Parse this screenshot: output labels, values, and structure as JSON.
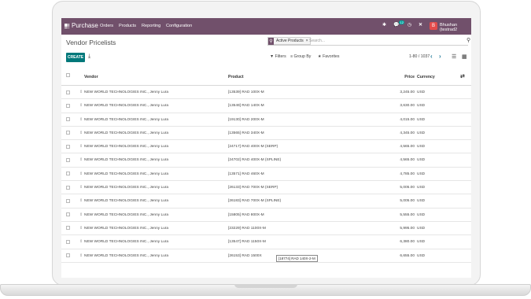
{
  "navbar": {
    "brand": "Purchase",
    "menu": [
      "Orders",
      "Products",
      "Reporting",
      "Configuration"
    ],
    "message_count": "12",
    "user_initial": "B",
    "user_name": "Bhushan (testrad2",
    "bar_color": "#71506b"
  },
  "page": {
    "title": "Vendor Pricelists",
    "create_label": "CREATE"
  },
  "search": {
    "facet_label": "Active Products",
    "facet_close": "×",
    "placeholder": "Search..."
  },
  "controls": {
    "filters": "Filters",
    "group_by": "Group By",
    "favorites": "Favorites",
    "pager": "1-80 / 1037"
  },
  "table": {
    "headers": {
      "vendor": "Vendor",
      "product": "Product",
      "price": "Price",
      "currency": "Currency"
    },
    "rows": [
      {
        "vendor": "NEW WORLD TECHNOLOGIES INC., Jenny Lura",
        "product": "[13539] RAD 100X-M",
        "price": "3,245.00",
        "currency": "USD"
      },
      {
        "vendor": "NEW WORLD TECHNOLOGIES INC., Jenny Lura",
        "product": "[13549] RAD 140X-M",
        "price": "3,630.00",
        "currency": "USD"
      },
      {
        "vendor": "NEW WORLD TECHNOLOGIES INC., Jenny Lura",
        "product": "[19130] RAD 200X-M",
        "price": "4,015.00",
        "currency": "USD"
      },
      {
        "vendor": "NEW WORLD TECHNOLOGIES INC., Jenny Lura",
        "product": "[13565] RAD 340X-M",
        "price": "4,345.00",
        "currency": "USD"
      },
      {
        "vendor": "NEW WORLD TECHNOLOGIES INC., Jenny Lura",
        "product": "[24717] RAD 400X-M (SERP)",
        "price": "4,565.00",
        "currency": "USD"
      },
      {
        "vendor": "NEW WORLD TECHNOLOGIES INC., Jenny Lura",
        "product": "[24702] RAD 400X-M (SPLINE)",
        "price": "4,565.00",
        "currency": "USD"
      },
      {
        "vendor": "NEW WORLD TECHNOLOGIES INC., Jenny Lura",
        "product": "[13571] RAD 460X-M",
        "price": "4,785.00",
        "currency": "USD"
      },
      {
        "vendor": "NEW WORLD TECHNOLOGIES INC., Jenny Lura",
        "product": "[26133] RAD 700X-M (SERP)",
        "price": "5,005.00",
        "currency": "USD"
      },
      {
        "vendor": "NEW WORLD TECHNOLOGIES INC., Jenny Lura",
        "product": "[26183] RAD 700X-M (SPLINE)",
        "price": "5,005.00",
        "currency": "USD"
      },
      {
        "vendor": "NEW WORLD TECHNOLOGIES INC., Jenny Lura",
        "product": "[15805] RAD 800X-M",
        "price": "5,555.00",
        "currency": "USD"
      },
      {
        "vendor": "NEW WORLD TECHNOLOGIES INC., Jenny Lura",
        "product": "[23229] RAD 1100X-M",
        "price": "5,995.00",
        "currency": "USD"
      },
      {
        "vendor": "NEW WORLD TECHNOLOGIES INC., Jenny Lura",
        "product": "[13547] RAD 1150X-M",
        "price": "6,380.00",
        "currency": "USD"
      },
      {
        "vendor": "NEW WORLD TECHNOLOGIES INC., Jenny Lura",
        "product": "[26153] RAD 1500X",
        "price": "6,655.00",
        "currency": "USD"
      }
    ],
    "tooltip": "[18774] RAD 140X-2-M"
  }
}
